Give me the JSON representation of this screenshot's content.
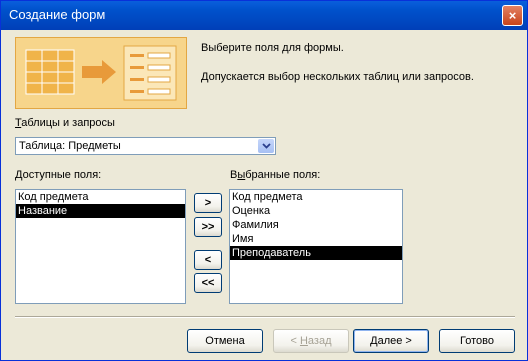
{
  "window": {
    "title": "Создание форм",
    "close": "×"
  },
  "header": {
    "line1": "Выберите поля для формы.",
    "line2": "Допускается выбор нескольких таблиц или запросов."
  },
  "tables": {
    "label_underlined": "Т",
    "label_rest": "аблицы и запросы",
    "selected": "Таблица: Предметы"
  },
  "available": {
    "label_underlined": "Д",
    "label_rest": "оступные поля:",
    "items": [
      "Код предмета",
      "Название"
    ],
    "selected_index": 1
  },
  "chosen": {
    "label_pre": "В",
    "label_underlined": "ы",
    "label_rest": "бранные поля:",
    "items": [
      "Код предмета",
      "Оценка",
      "Фамилия",
      "Имя",
      "Преподаватель"
    ],
    "selected_index": 4
  },
  "move_buttons": {
    "add": ">",
    "add_all": ">>",
    "remove": "<",
    "remove_all": "<<"
  },
  "footer": {
    "cancel": "Отмена",
    "back_prefix": "< ",
    "back_underlined": "Н",
    "back_rest": "азад",
    "next_underlined": "Д",
    "next_rest": "алее >",
    "finish": "Готово"
  },
  "colors": {
    "title_bar": "#0052cc",
    "selection": "#000000",
    "dialog_bg": "#ece9d8"
  }
}
